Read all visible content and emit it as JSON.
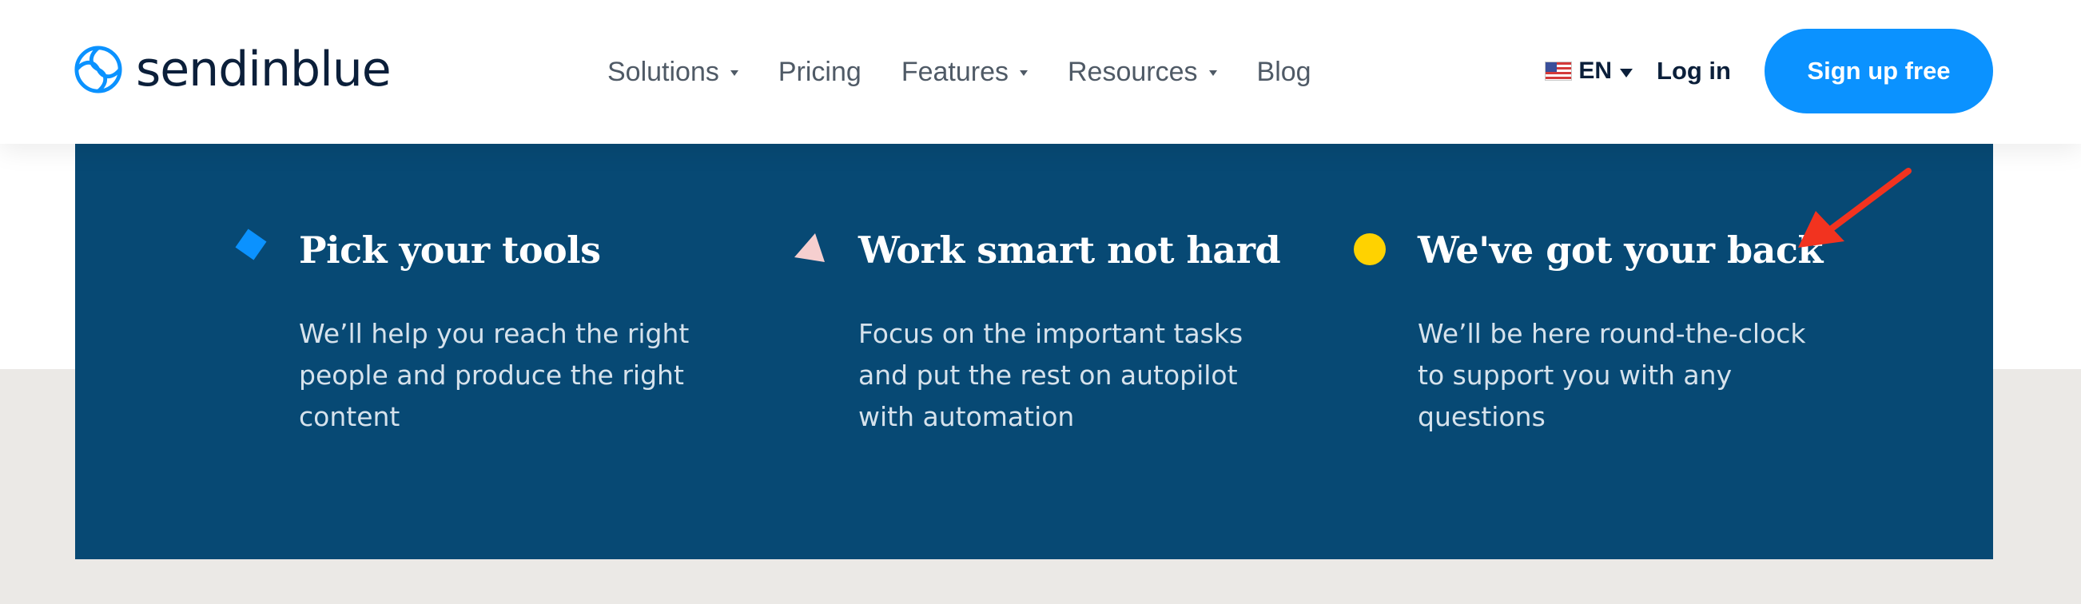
{
  "header": {
    "brand": "sendinblue",
    "nav": [
      {
        "label": "Solutions",
        "has_dropdown": true
      },
      {
        "label": "Pricing",
        "has_dropdown": false
      },
      {
        "label": "Features",
        "has_dropdown": true
      },
      {
        "label": "Resources",
        "has_dropdown": true
      },
      {
        "label": "Blog",
        "has_dropdown": false
      }
    ],
    "language": "EN",
    "login_label": "Log in",
    "signup_label": "Sign up free"
  },
  "features": [
    {
      "title": "Pick your tools",
      "description": "We’ll help you reach the right people and produce the right content",
      "icon": "blue-diamond-icon"
    },
    {
      "title": "Work smart not hard",
      "description": "Focus on the important tasks and put the rest on autopilot with automation",
      "icon": "pink-triangle-icon"
    },
    {
      "title": "We've got your back",
      "description": "We’ll be here round-the-clock to support you with any questions",
      "icon": "yellow-circle-icon"
    }
  ],
  "colors": {
    "brand_dark": "#0b1f3a",
    "primary_button": "#0b92ff",
    "panel_background": "#074974",
    "page_gray": "#ebe9e6",
    "diamond": "#0b92ff",
    "triangle": "#f6cfcf",
    "circle": "#ffd200",
    "annotation_arrow": "#f2331f"
  }
}
